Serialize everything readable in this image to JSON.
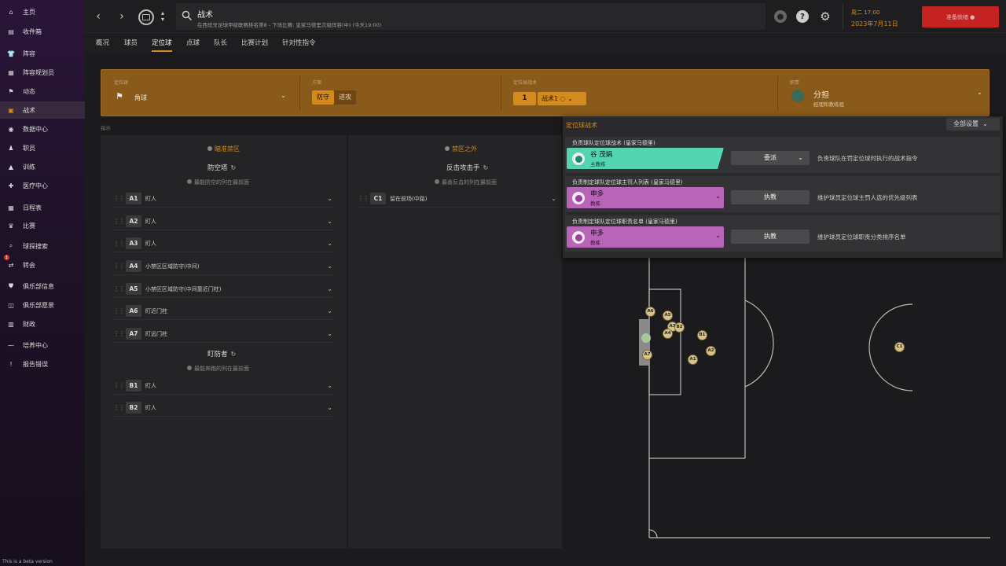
{
  "sidebar": {
    "items": [
      {
        "label": "主页",
        "icon": "home-icon"
      },
      {
        "label": "收件箱",
        "icon": "inbox-icon"
      },
      {
        "label": "阵容",
        "icon": "shirt-icon"
      },
      {
        "label": "阵容规划员",
        "icon": "planner-icon"
      },
      {
        "label": "动态",
        "icon": "dynamics-icon"
      },
      {
        "label": "战术",
        "icon": "tactics-icon",
        "active": true
      },
      {
        "label": "数据中心",
        "icon": "data-icon"
      },
      {
        "label": "职员",
        "icon": "staff-icon"
      },
      {
        "label": "训练",
        "icon": "training-icon"
      },
      {
        "label": "医疗中心",
        "icon": "medical-icon"
      },
      {
        "label": "日程表",
        "icon": "calendar-icon"
      },
      {
        "label": "比赛",
        "icon": "trophy-icon"
      },
      {
        "label": "球探搜索",
        "icon": "scout-icon"
      },
      {
        "label": "转会",
        "icon": "transfer-icon"
      },
      {
        "label": "俱乐部信息",
        "icon": "shield-icon"
      },
      {
        "label": "俱乐部愿景",
        "icon": "vision-icon"
      },
      {
        "label": "财政",
        "icon": "finance-icon"
      },
      {
        "label": "培养中心",
        "icon": "development-icon"
      },
      {
        "label": "报告错误",
        "icon": "alert-icon"
      }
    ],
    "transfer_badge": "1",
    "beta_text": "This is a beta version"
  },
  "topbar": {
    "title": "战术",
    "subtitle": "在西班牙足球甲级联赛排名第8 - 下场比赛: 皇家马德里次级阵容(中) (今天19:00)",
    "date_line1": "周二 17:00",
    "date_line2": "2023年7月11日",
    "continue_label": "准备就绪"
  },
  "tabs": [
    "概况",
    "球员",
    "定位球",
    "点球",
    "队长",
    "比赛计划",
    "针对性指令"
  ],
  "setpiece_bar": {
    "label1": "定位球",
    "value1": "角球",
    "label2": "方案",
    "seg_on": "防守",
    "seg_off": "进攻",
    "label3": "定位球战术",
    "num": "1",
    "tactic": "战术1",
    "label4": "职责",
    "duty": "分担",
    "duty_sub": "经理和教练组"
  },
  "hint_label": "指示",
  "left_col": {
    "title": "瞄准禁区",
    "group1_title": "防空塔",
    "group1_note": "最能防空的列在最前面",
    "slots1": [
      {
        "pos": "A1",
        "label": "盯人"
      },
      {
        "pos": "A2",
        "label": "盯人"
      },
      {
        "pos": "A3",
        "label": "盯人"
      },
      {
        "pos": "A4",
        "label": "小禁区区域防守(中间)"
      },
      {
        "pos": "A5",
        "label": "小禁区区域防守(中间靠近门柱)"
      },
      {
        "pos": "A6",
        "label": "盯近门柱"
      },
      {
        "pos": "A7",
        "label": "盯远门柱"
      }
    ],
    "group2_title": "盯防者",
    "group2_note": "最能奔跑的列在最前面",
    "slots2": [
      {
        "pos": "B1",
        "label": "盯人"
      },
      {
        "pos": "B2",
        "label": "盯人"
      }
    ]
  },
  "mid_col": {
    "title": "禁区之外",
    "group_title": "反击攻击手",
    "group_note": "最善反击的列在最前面",
    "slots": [
      {
        "pos": "C1",
        "label": "留在前场(中路)"
      }
    ]
  },
  "popup": {
    "title": "定位球战术",
    "all_settings": "全部设置",
    "cards": [
      {
        "title": "负责球队定位球战术 (皇家马德里)",
        "name": "谷 茂娟",
        "role": "主教练",
        "action": "委派",
        "has_chev": true,
        "desc": "负责球队在罚定位球时执行的战术指令",
        "color": "#54d4b0",
        "avatar_color": "#1d8a70"
      },
      {
        "title": "负责制定球队定位球主罚人列表 (皇家马德里)",
        "name": "申多",
        "role": "教练",
        "action": "执教",
        "has_chev": false,
        "desc": "维护球员定位球主罚人选的优先级列表",
        "color": "#b864b8",
        "avatar_color": "#a03ea0"
      },
      {
        "title": "负责制定球队定位球职责名单 (皇家马德里)",
        "name": "申多",
        "role": "教练",
        "action": "执教",
        "has_chev": false,
        "desc": "维护球员定位球职责分类排序名单",
        "color": "#b864b8",
        "avatar_color": "#a03ea0"
      }
    ]
  },
  "pitch_markers": [
    "A6",
    "A5",
    "A3",
    "B2",
    "A4",
    "B1",
    "A7",
    "A1",
    "A2",
    "C1"
  ]
}
